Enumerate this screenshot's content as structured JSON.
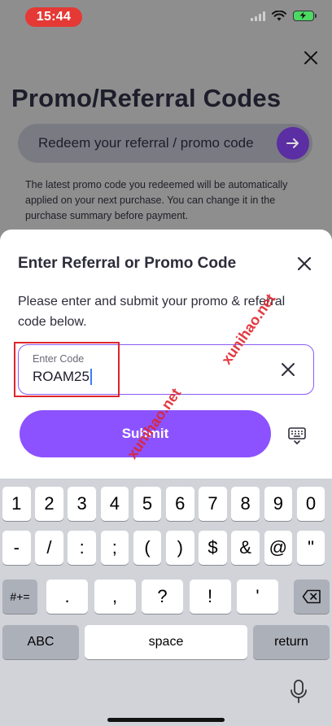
{
  "status_bar": {
    "time": "15:44"
  },
  "background": {
    "title": "Promo/Referral Codes",
    "redeem_placeholder": "Redeem your referral / promo code",
    "note": "The latest promo code you redeemed will be automatically applied on your next purchase. You can change it in the purchase summary before payment."
  },
  "sheet": {
    "title": "Enter Referral or Promo Code",
    "description": "Please enter and submit your promo & referral code below.",
    "field_label": "Enter Code",
    "field_value": "ROAM25",
    "submit_label": "Submit"
  },
  "watermarks": [
    "xunihao.net",
    "xunihao.net"
  ],
  "keyboard": {
    "row1": [
      "1",
      "2",
      "3",
      "4",
      "5",
      "6",
      "7",
      "8",
      "9",
      "0"
    ],
    "row2": [
      "-",
      "/",
      ":",
      ";",
      "(",
      ")",
      "$",
      "&",
      "@",
      "\""
    ],
    "row3_left": "#+=",
    "row3": [
      ".",
      ",",
      "?",
      "!",
      "'"
    ],
    "abc": "ABC",
    "space": "space",
    "return": "return"
  },
  "colors": {
    "accent": "#8c52ff",
    "accent_dark": "#5b2ea3",
    "highlight": "#e0242c",
    "time_pill": "#e53935"
  }
}
